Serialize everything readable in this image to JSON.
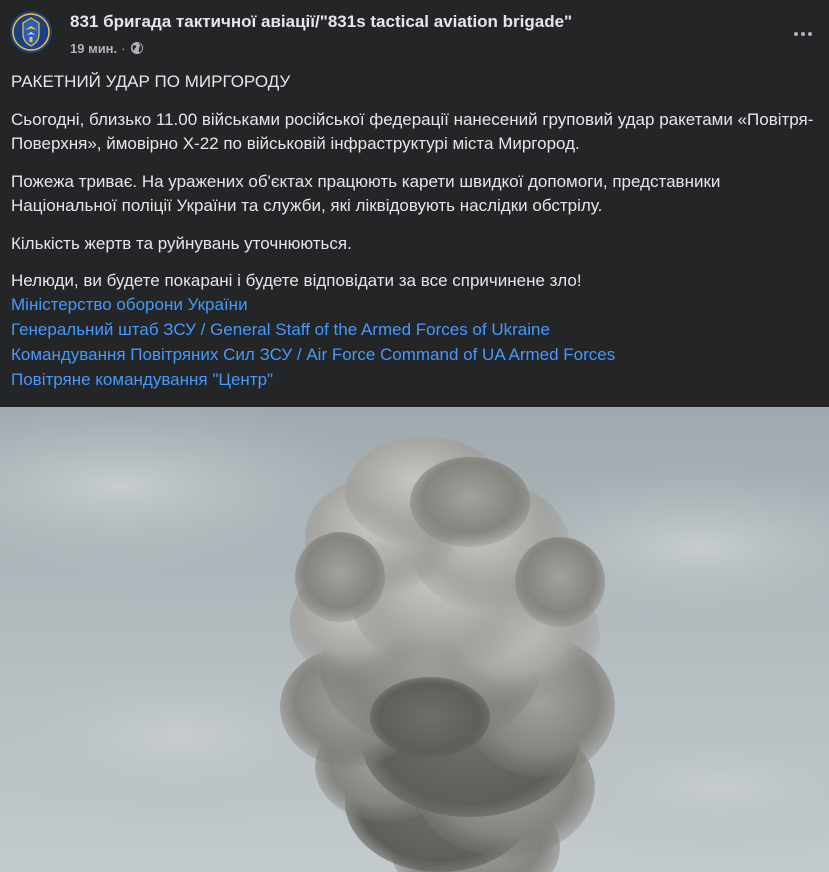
{
  "post": {
    "author": "831 бригада тактичної авіації/\"831s tactical aviation brigade\"",
    "time": "19 мин.",
    "separator": "·",
    "privacy_icon": "globe-icon",
    "more_icon": "more-options-icon",
    "paragraphs": [
      "РАКЕТНИЙ УДАР ПО МИРГОРОДУ",
      "Сьогодні, близько 11.00 військами російської федерації нанесений груповий удар ракетами «Повітря-Поверхня», ймовірно Х-22 по військовій інфраструктурі міста Миргород.",
      "Пожежа триває. На уражених об'єктах працюють карети швидкої допомоги, представники Національної поліції України та служби, які ліквідовують наслідки обстрілу.",
      "Кількість жертв та руйнувань уточнюються.",
      "Нелюди, ви будете покарані і будете відповідати за все спричинене зло!"
    ],
    "links": [
      "Міністерство оборони України",
      "Генеральний штаб ЗСУ / General Staff of the Armed Forces of Ukraine",
      "Командування Повітряних Сил ЗСУ / Air Force Command of UA Armed Forces",
      "Повітряне командування \"Центр\""
    ]
  },
  "colors": {
    "background": "#242526",
    "text": "#e4e6eb",
    "secondary_text": "#b0b3b8",
    "link": "#4599ff",
    "avatar_bg": "#1d3f86"
  }
}
